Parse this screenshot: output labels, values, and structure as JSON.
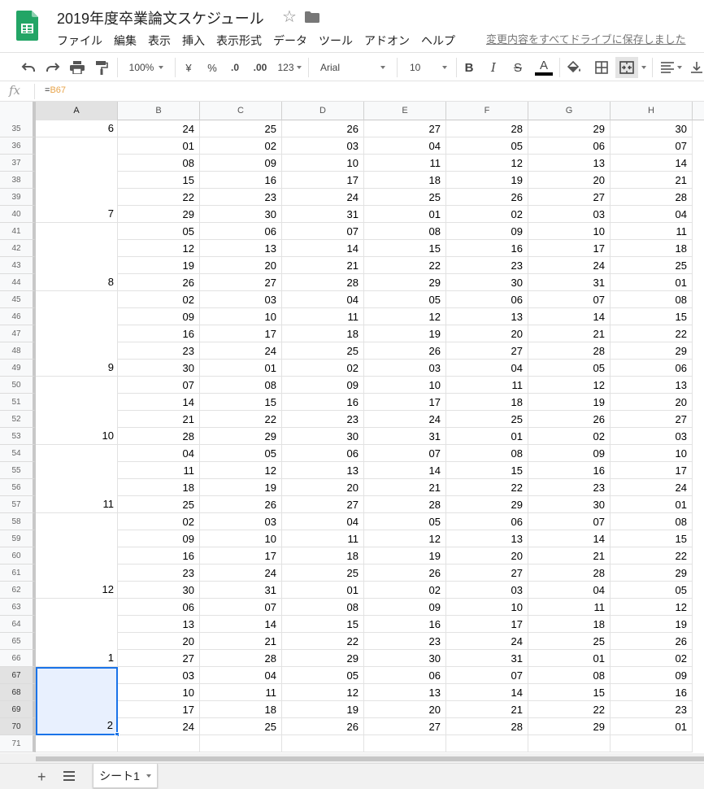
{
  "document": {
    "title": "2019年度卒業論文スケジュール",
    "save_status": "変更内容をすべてドライブに保存しました"
  },
  "menu": [
    "ファイル",
    "編集",
    "表示",
    "挿入",
    "表示形式",
    "データ",
    "ツール",
    "アドオン",
    "ヘルプ"
  ],
  "toolbar": {
    "zoom": "100%",
    "currency": "¥",
    "percent": "%",
    "decrease_decimal": ".0",
    "increase_decimal": ".00",
    "number_format": "123",
    "font": "Arial",
    "font_size": "10",
    "bold": "B",
    "italic": "I",
    "strike": "S",
    "text_color_letter": "A",
    "text_color": "#000000"
  },
  "formula": {
    "prefix": "=",
    "reference": "B67"
  },
  "columns": [
    "A",
    "B",
    "C",
    "D",
    "E",
    "F",
    "G",
    "H"
  ],
  "selected_column": "A",
  "rows": [
    {
      "n": "35",
      "v": [
        "24",
        "25",
        "26",
        "27",
        "28",
        "29",
        "30"
      ]
    },
    {
      "n": "36",
      "v": [
        "01",
        "02",
        "03",
        "04",
        "05",
        "06",
        "07"
      ]
    },
    {
      "n": "37",
      "v": [
        "08",
        "09",
        "10",
        "11",
        "12",
        "13",
        "14"
      ]
    },
    {
      "n": "38",
      "v": [
        "15",
        "16",
        "17",
        "18",
        "19",
        "20",
        "21"
      ]
    },
    {
      "n": "39",
      "v": [
        "22",
        "23",
        "24",
        "25",
        "26",
        "27",
        "28"
      ]
    },
    {
      "n": "40",
      "v": [
        "29",
        "30",
        "31",
        "01",
        "02",
        "03",
        "04"
      ]
    },
    {
      "n": "41",
      "v": [
        "05",
        "06",
        "07",
        "08",
        "09",
        "10",
        "11"
      ]
    },
    {
      "n": "42",
      "v": [
        "12",
        "13",
        "14",
        "15",
        "16",
        "17",
        "18"
      ]
    },
    {
      "n": "43",
      "v": [
        "19",
        "20",
        "21",
        "22",
        "23",
        "24",
        "25"
      ]
    },
    {
      "n": "44",
      "v": [
        "26",
        "27",
        "28",
        "29",
        "30",
        "31",
        "01"
      ]
    },
    {
      "n": "45",
      "v": [
        "02",
        "03",
        "04",
        "05",
        "06",
        "07",
        "08"
      ]
    },
    {
      "n": "46",
      "v": [
        "09",
        "10",
        "11",
        "12",
        "13",
        "14",
        "15"
      ]
    },
    {
      "n": "47",
      "v": [
        "16",
        "17",
        "18",
        "19",
        "20",
        "21",
        "22"
      ]
    },
    {
      "n": "48",
      "v": [
        "23",
        "24",
        "25",
        "26",
        "27",
        "28",
        "29"
      ]
    },
    {
      "n": "49",
      "v": [
        "30",
        "01",
        "02",
        "03",
        "04",
        "05",
        "06"
      ]
    },
    {
      "n": "50",
      "v": [
        "07",
        "08",
        "09",
        "10",
        "11",
        "12",
        "13"
      ]
    },
    {
      "n": "51",
      "v": [
        "14",
        "15",
        "16",
        "17",
        "18",
        "19",
        "20"
      ]
    },
    {
      "n": "52",
      "v": [
        "21",
        "22",
        "23",
        "24",
        "25",
        "26",
        "27"
      ]
    },
    {
      "n": "53",
      "v": [
        "28",
        "29",
        "30",
        "31",
        "01",
        "02",
        "03"
      ]
    },
    {
      "n": "54",
      "v": [
        "04",
        "05",
        "06",
        "07",
        "08",
        "09",
        "10"
      ]
    },
    {
      "n": "55",
      "v": [
        "11",
        "12",
        "13",
        "14",
        "15",
        "16",
        "17"
      ]
    },
    {
      "n": "56",
      "v": [
        "18",
        "19",
        "20",
        "21",
        "22",
        "23",
        "24"
      ]
    },
    {
      "n": "57",
      "v": [
        "25",
        "26",
        "27",
        "28",
        "29",
        "30",
        "01"
      ]
    },
    {
      "n": "58",
      "v": [
        "02",
        "03",
        "04",
        "05",
        "06",
        "07",
        "08"
      ]
    },
    {
      "n": "59",
      "v": [
        "09",
        "10",
        "11",
        "12",
        "13",
        "14",
        "15"
      ]
    },
    {
      "n": "60",
      "v": [
        "16",
        "17",
        "18",
        "19",
        "20",
        "21",
        "22"
      ]
    },
    {
      "n": "61",
      "v": [
        "23",
        "24",
        "25",
        "26",
        "27",
        "28",
        "29"
      ]
    },
    {
      "n": "62",
      "v": [
        "30",
        "31",
        "01",
        "02",
        "03",
        "04",
        "05"
      ]
    },
    {
      "n": "63",
      "v": [
        "06",
        "07",
        "08",
        "09",
        "10",
        "11",
        "12"
      ]
    },
    {
      "n": "64",
      "v": [
        "13",
        "14",
        "15",
        "16",
        "17",
        "18",
        "19"
      ]
    },
    {
      "n": "65",
      "v": [
        "20",
        "21",
        "22",
        "23",
        "24",
        "25",
        "26"
      ]
    },
    {
      "n": "66",
      "v": [
        "27",
        "28",
        "29",
        "30",
        "31",
        "01",
        "02"
      ]
    },
    {
      "n": "67",
      "v": [
        "03",
        "04",
        "05",
        "06",
        "07",
        "08",
        "09"
      ]
    },
    {
      "n": "68",
      "v": [
        "10",
        "11",
        "12",
        "13",
        "14",
        "15",
        "16"
      ]
    },
    {
      "n": "69",
      "v": [
        "17",
        "18",
        "19",
        "20",
        "21",
        "22",
        "23"
      ]
    },
    {
      "n": "70",
      "v": [
        "24",
        "25",
        "26",
        "27",
        "28",
        "29",
        "01"
      ]
    },
    {
      "n": "71",
      "v": [
        "",
        "",
        "",
        "",
        "",
        "",
        ""
      ]
    }
  ],
  "month_groups": [
    {
      "label": "6",
      "start": 0,
      "span": 1
    },
    {
      "label": "7",
      "start": 1,
      "span": 5
    },
    {
      "label": "8",
      "start": 6,
      "span": 4
    },
    {
      "label": "9",
      "start": 10,
      "span": 5
    },
    {
      "label": "10",
      "start": 15,
      "span": 4
    },
    {
      "label": "11",
      "start": 19,
      "span": 4
    },
    {
      "label": "12",
      "start": 23,
      "span": 5
    },
    {
      "label": "1",
      "start": 28,
      "span": 4
    },
    {
      "label": "2",
      "start": 32,
      "span": 4,
      "selected": true
    },
    {
      "label": "",
      "start": 36,
      "span": 1
    }
  ],
  "selected_rows": [
    "67",
    "68",
    "69",
    "70"
  ],
  "sheet": {
    "add_icon": "plus-icon",
    "list_icon": "list-icon",
    "tab_label": "シート1"
  }
}
